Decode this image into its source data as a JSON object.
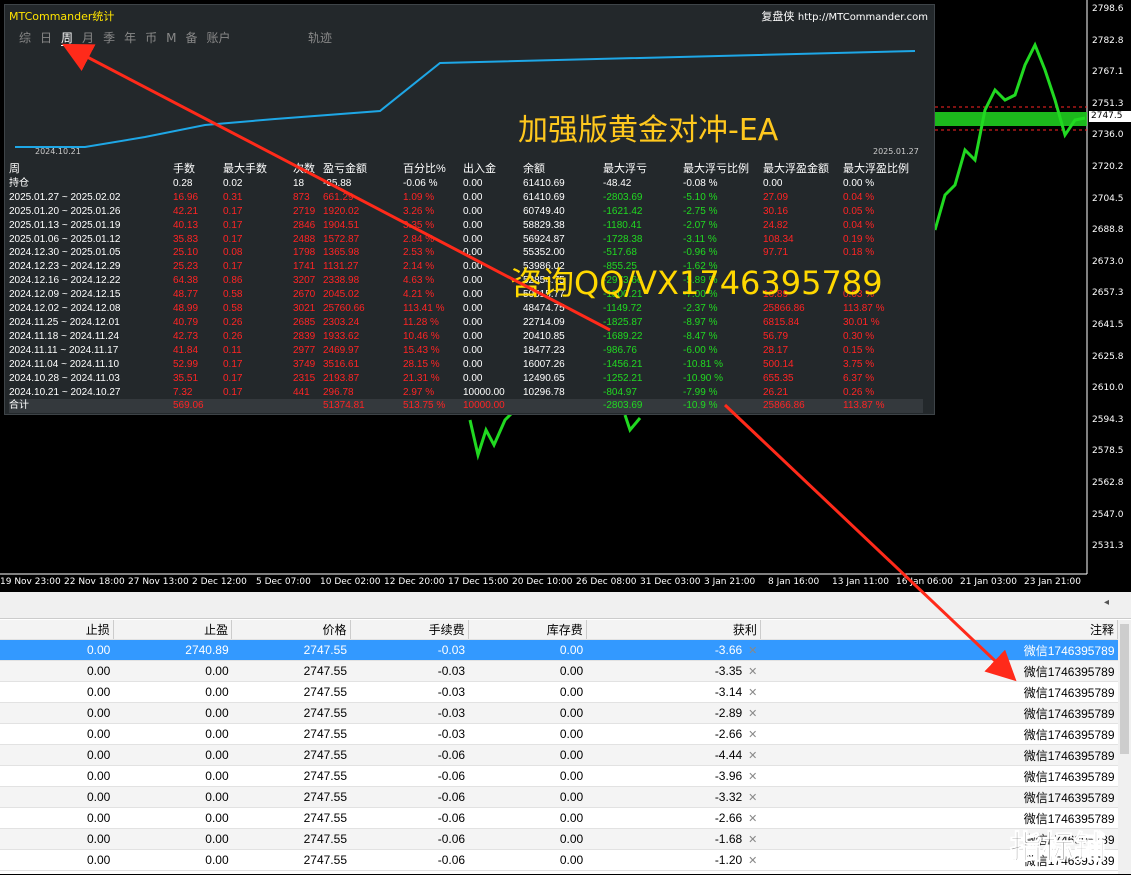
{
  "price_axis": [
    "2798.6",
    "2782.8",
    "2767.1",
    "2751.3",
    "2736.0",
    "2720.2",
    "2704.5",
    "2688.8",
    "2673.0",
    "2657.3",
    "2641.5",
    "2625.8",
    "2610.0",
    "2594.3",
    "2578.5",
    "2562.8",
    "2547.0",
    "2531.3"
  ],
  "current_price": "2747.5",
  "time_axis": [
    "19 Nov 23:00",
    "22 Nov 18:00",
    "27 Nov 13:00",
    "2 Dec 12:00",
    "5 Dec 07:00",
    "10 Dec 02:00",
    "12 Dec 20:00",
    "17 Dec 15:00",
    "20 Dec 10:00",
    "26 Dec 08:00",
    "31 Dec 03:00",
    "3 Jan 21:00",
    "8 Jan 16:00",
    "13 Jan 11:00",
    "16 Jan 06:00",
    "21 Jan 03:00",
    "23 Jan 21:00"
  ],
  "panel": {
    "title": "MTCommander统计",
    "link_name": "复盘侠",
    "link_url": "http://MTCommander.com",
    "tabs": [
      "综",
      "日",
      "周",
      "月",
      "季",
      "年",
      "币",
      "M",
      "备",
      "账户"
    ],
    "active_tab": "周",
    "track_label": "轨迹",
    "curve_start_date": "2024.10.21",
    "curve_end_date": "2025.01.27",
    "headline": "加强版黄金对冲-EA",
    "watermark": "咨询QQ/VX1746395789",
    "columns": [
      "周",
      "手数",
      "最大手数",
      "次数",
      "盈亏金额",
      "百分比%",
      "出入金",
      "余额",
      "最大浮亏",
      "最大浮亏比例",
      "最大浮盈金额",
      "最大浮盈比例"
    ],
    "holding": {
      "label": "持仓",
      "lots": "0.28",
      "max_lots": "0.02",
      "count": "18",
      "pnl": "-35.88",
      "pct": "-0.06 %",
      "deposit": "0.00",
      "balance": "61410.69",
      "max_dd": "-48.42",
      "max_dd_pct": "-0.08 %",
      "max_fp": "0.00",
      "max_fp_pct": "0.00 %"
    },
    "rows": [
      {
        "period": "2025.01.27 ~ 2025.02.02",
        "lots": "16.96",
        "max_lots": "0.31",
        "count": "873",
        "pnl": "661.29",
        "pct": "1.09 %",
        "deposit": "0.00",
        "balance": "61410.69",
        "max_dd": "-2803.69",
        "max_dd_pct": "-5.10 %",
        "max_fp": "27.09",
        "max_fp_pct": "0.04 %"
      },
      {
        "period": "2025.01.20 ~ 2025.01.26",
        "lots": "42.21",
        "max_lots": "0.17",
        "count": "2719",
        "pnl": "1920.02",
        "pct": "3.26 %",
        "deposit": "0.00",
        "balance": "60749.40",
        "max_dd": "-1621.42",
        "max_dd_pct": "-2.75 %",
        "max_fp": "30.16",
        "max_fp_pct": "0.05 %"
      },
      {
        "period": "2025.01.13 ~ 2025.01.19",
        "lots": "40.13",
        "max_lots": "0.17",
        "count": "2846",
        "pnl": "1904.51",
        "pct": "3.35 %",
        "deposit": "0.00",
        "balance": "58829.38",
        "max_dd": "-1180.41",
        "max_dd_pct": "-2.07 %",
        "max_fp": "24.82",
        "max_fp_pct": "0.04 %"
      },
      {
        "period": "2025.01.06 ~ 2025.01.12",
        "lots": "35.83",
        "max_lots": "0.17",
        "count": "2488",
        "pnl": "1572.87",
        "pct": "2.84 %",
        "deposit": "0.00",
        "balance": "56924.87",
        "max_dd": "-1728.38",
        "max_dd_pct": "-3.11 %",
        "max_fp": "108.34",
        "max_fp_pct": "0.19 %"
      },
      {
        "period": "2024.12.30 ~ 2025.01.05",
        "lots": "25.10",
        "max_lots": "0.08",
        "count": "1798",
        "pnl": "1365.98",
        "pct": "2.53 %",
        "deposit": "0.00",
        "balance": "55352.00",
        "max_dd": "-517.68",
        "max_dd_pct": "-0.96 %",
        "max_fp": "97.71",
        "max_fp_pct": "0.18 %"
      },
      {
        "period": "2024.12.23 ~ 2024.12.29",
        "lots": "25.23",
        "max_lots": "0.17",
        "count": "1741",
        "pnl": "1131.27",
        "pct": "2.14 %",
        "deposit": "0.00",
        "balance": "53986.02",
        "max_dd": "-855.25",
        "max_dd_pct": "-1.62 %",
        "max_fp": "",
        "max_fp_pct": ""
      },
      {
        "period": "2024.12.16 ~ 2024.12.22",
        "lots": "64.38",
        "max_lots": "0.86",
        "count": "3207",
        "pnl": "2338.98",
        "pct": "4.63 %",
        "deposit": "0.00",
        "balance": "52854.75",
        "max_dd": "-2973.66",
        "max_dd_pct": "-5.89 %",
        "max_fp": "",
        "max_fp_pct": ""
      },
      {
        "period": "2024.12.09 ~ 2024.12.15",
        "lots": "48.77",
        "max_lots": "0.58",
        "count": "2670",
        "pnl": "2045.02",
        "pct": "4.21 %",
        "deposit": "0.00",
        "balance": "50515.77",
        "max_dd": "-1800.21",
        "max_dd_pct": "-7.00 %",
        "max_fp": "16.89",
        "max_fp_pct": "0.03 %"
      },
      {
        "period": "2024.12.02 ~ 2024.12.08",
        "lots": "48.99",
        "max_lots": "0.58",
        "count": "3021",
        "pnl": "25760.66",
        "pct": "113.41 %",
        "deposit": "0.00",
        "balance": "48474.75",
        "max_dd": "-1149.72",
        "max_dd_pct": "-2.37 %",
        "max_fp": "25866.86",
        "max_fp_pct": "113.87 %"
      },
      {
        "period": "2024.11.25 ~ 2024.12.01",
        "lots": "40.79",
        "max_lots": "0.26",
        "count": "2685",
        "pnl": "2303.24",
        "pct": "11.28 %",
        "deposit": "0.00",
        "balance": "22714.09",
        "max_dd": "-1825.87",
        "max_dd_pct": "-8.97 %",
        "max_fp": "6815.84",
        "max_fp_pct": "30.01 %"
      },
      {
        "period": "2024.11.18 ~ 2024.11.24",
        "lots": "42.73",
        "max_lots": "0.26",
        "count": "2839",
        "pnl": "1933.62",
        "pct": "10.46 %",
        "deposit": "0.00",
        "balance": "20410.85",
        "max_dd": "-1689.22",
        "max_dd_pct": "-8.47 %",
        "max_fp": "56.79",
        "max_fp_pct": "0.30 %"
      },
      {
        "period": "2024.11.11 ~ 2024.11.17",
        "lots": "41.84",
        "max_lots": "0.11",
        "count": "2977",
        "pnl": "2469.97",
        "pct": "15.43 %",
        "deposit": "0.00",
        "balance": "18477.23",
        "max_dd": "-986.76",
        "max_dd_pct": "-6.00 %",
        "max_fp": "28.17",
        "max_fp_pct": "0.15 %"
      },
      {
        "period": "2024.11.04 ~ 2024.11.10",
        "lots": "52.99",
        "max_lots": "0.17",
        "count": "3749",
        "pnl": "3516.61",
        "pct": "28.15 %",
        "deposit": "0.00",
        "balance": "16007.26",
        "max_dd": "-1456.21",
        "max_dd_pct": "-10.81 %",
        "max_fp": "500.14",
        "max_fp_pct": "3.75 %"
      },
      {
        "period": "2024.10.28 ~ 2024.11.03",
        "lots": "35.51",
        "max_lots": "0.17",
        "count": "2315",
        "pnl": "2193.87",
        "pct": "21.31 %",
        "deposit": "0.00",
        "balance": "12490.65",
        "max_dd": "-1252.21",
        "max_dd_pct": "-10.90 %",
        "max_fp": "655.35",
        "max_fp_pct": "6.37 %"
      },
      {
        "period": "2024.10.21 ~ 2024.10.27",
        "lots": "7.32",
        "max_lots": "0.17",
        "count": "441",
        "pnl": "296.78",
        "pct": "2.97 %",
        "deposit": "10000.00",
        "balance": "10296.78",
        "max_dd": "-804.97",
        "max_dd_pct": "-7.99 %",
        "max_fp": "26.21",
        "max_fp_pct": "0.26 %"
      }
    ],
    "total": {
      "label": "合计",
      "lots": "569.06",
      "pnl": "51374.81",
      "pct": "513.75 %",
      "deposit": "10000.00",
      "max_dd": "-2803.69",
      "max_dd_pct": "-10.9 %",
      "max_fp": "25866.86",
      "max_fp_pct": "113.87 %"
    }
  },
  "orders": {
    "columns": [
      "止损",
      "止盈",
      "价格",
      "手续费",
      "库存费",
      "获利",
      "注释"
    ],
    "rows": [
      {
        "sl": "0.00",
        "tp": "2740.89",
        "price": "2747.55",
        "commission": "-0.03",
        "swap": "0.00",
        "profit": "-3.66",
        "comment": "微信1746395789"
      },
      {
        "sl": "0.00",
        "tp": "0.00",
        "price": "2747.55",
        "commission": "-0.03",
        "swap": "0.00",
        "profit": "-3.35",
        "comment": "微信1746395789"
      },
      {
        "sl": "0.00",
        "tp": "0.00",
        "price": "2747.55",
        "commission": "-0.03",
        "swap": "0.00",
        "profit": "-3.14",
        "comment": "微信1746395789"
      },
      {
        "sl": "0.00",
        "tp": "0.00",
        "price": "2747.55",
        "commission": "-0.03",
        "swap": "0.00",
        "profit": "-2.89",
        "comment": "微信1746395789"
      },
      {
        "sl": "0.00",
        "tp": "0.00",
        "price": "2747.55",
        "commission": "-0.03",
        "swap": "0.00",
        "profit": "-2.66",
        "comment": "微信1746395789"
      },
      {
        "sl": "0.00",
        "tp": "0.00",
        "price": "2747.55",
        "commission": "-0.06",
        "swap": "0.00",
        "profit": "-4.44",
        "comment": "微信1746395789"
      },
      {
        "sl": "0.00",
        "tp": "0.00",
        "price": "2747.55",
        "commission": "-0.06",
        "swap": "0.00",
        "profit": "-3.96",
        "comment": "微信1746395789"
      },
      {
        "sl": "0.00",
        "tp": "0.00",
        "price": "2747.55",
        "commission": "-0.06",
        "swap": "0.00",
        "profit": "-3.32",
        "comment": "微信1746395789"
      },
      {
        "sl": "0.00",
        "tp": "0.00",
        "price": "2747.55",
        "commission": "-0.06",
        "swap": "0.00",
        "profit": "-2.66",
        "comment": "微信1746395789"
      },
      {
        "sl": "0.00",
        "tp": "0.00",
        "price": "2747.55",
        "commission": "-0.06",
        "swap": "0.00",
        "profit": "-1.68",
        "comment": "微信1746395789"
      },
      {
        "sl": "0.00",
        "tp": "0.00",
        "price": "2747.55",
        "commission": "-0.06",
        "swap": "0.00",
        "profit": "-1.20",
        "comment": "微信1746395789"
      }
    ]
  },
  "corner_logo": "指标铺",
  "colors": {
    "bull": "#21d921",
    "loss": "#ff2424",
    "curve": "#1ea7e6",
    "select": "#3399ff",
    "arrow": "#ff2a1a"
  }
}
